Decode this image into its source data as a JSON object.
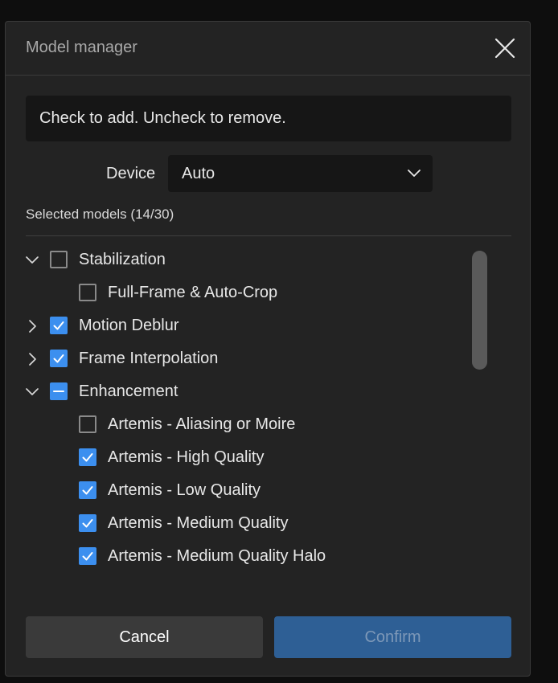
{
  "dialog": {
    "title": "Model manager",
    "close_icon": "close-icon"
  },
  "info_text": "Check to add. Uncheck to remove.",
  "device": {
    "label": "Device",
    "selected": "Auto"
  },
  "selected_models": "Selected models (14/30)",
  "tree": [
    {
      "label": "Stabilization",
      "level": 0,
      "expand": "expanded",
      "state": "unchecked"
    },
    {
      "label": "Full-Frame & Auto-Crop",
      "level": 1,
      "expand": "none",
      "state": "unchecked"
    },
    {
      "label": "Motion Deblur",
      "level": 0,
      "expand": "collapsed",
      "state": "checked"
    },
    {
      "label": "Frame Interpolation",
      "level": 0,
      "expand": "collapsed",
      "state": "checked"
    },
    {
      "label": "Enhancement",
      "level": 0,
      "expand": "expanded",
      "state": "partial"
    },
    {
      "label": "Artemis - Aliasing or Moire",
      "level": 1,
      "expand": "none",
      "state": "unchecked"
    },
    {
      "label": "Artemis - High Quality",
      "level": 1,
      "expand": "none",
      "state": "checked"
    },
    {
      "label": "Artemis - Low Quality",
      "level": 1,
      "expand": "none",
      "state": "checked"
    },
    {
      "label": "Artemis - Medium Quality",
      "level": 1,
      "expand": "none",
      "state": "checked"
    },
    {
      "label": "Artemis - Medium Quality Halo",
      "level": 1,
      "expand": "none",
      "state": "checked"
    }
  ],
  "buttons": {
    "cancel": "Cancel",
    "confirm": "Confirm"
  },
  "colors": {
    "accent": "#3c8fef",
    "confirm_bg": "#2e5f95"
  }
}
